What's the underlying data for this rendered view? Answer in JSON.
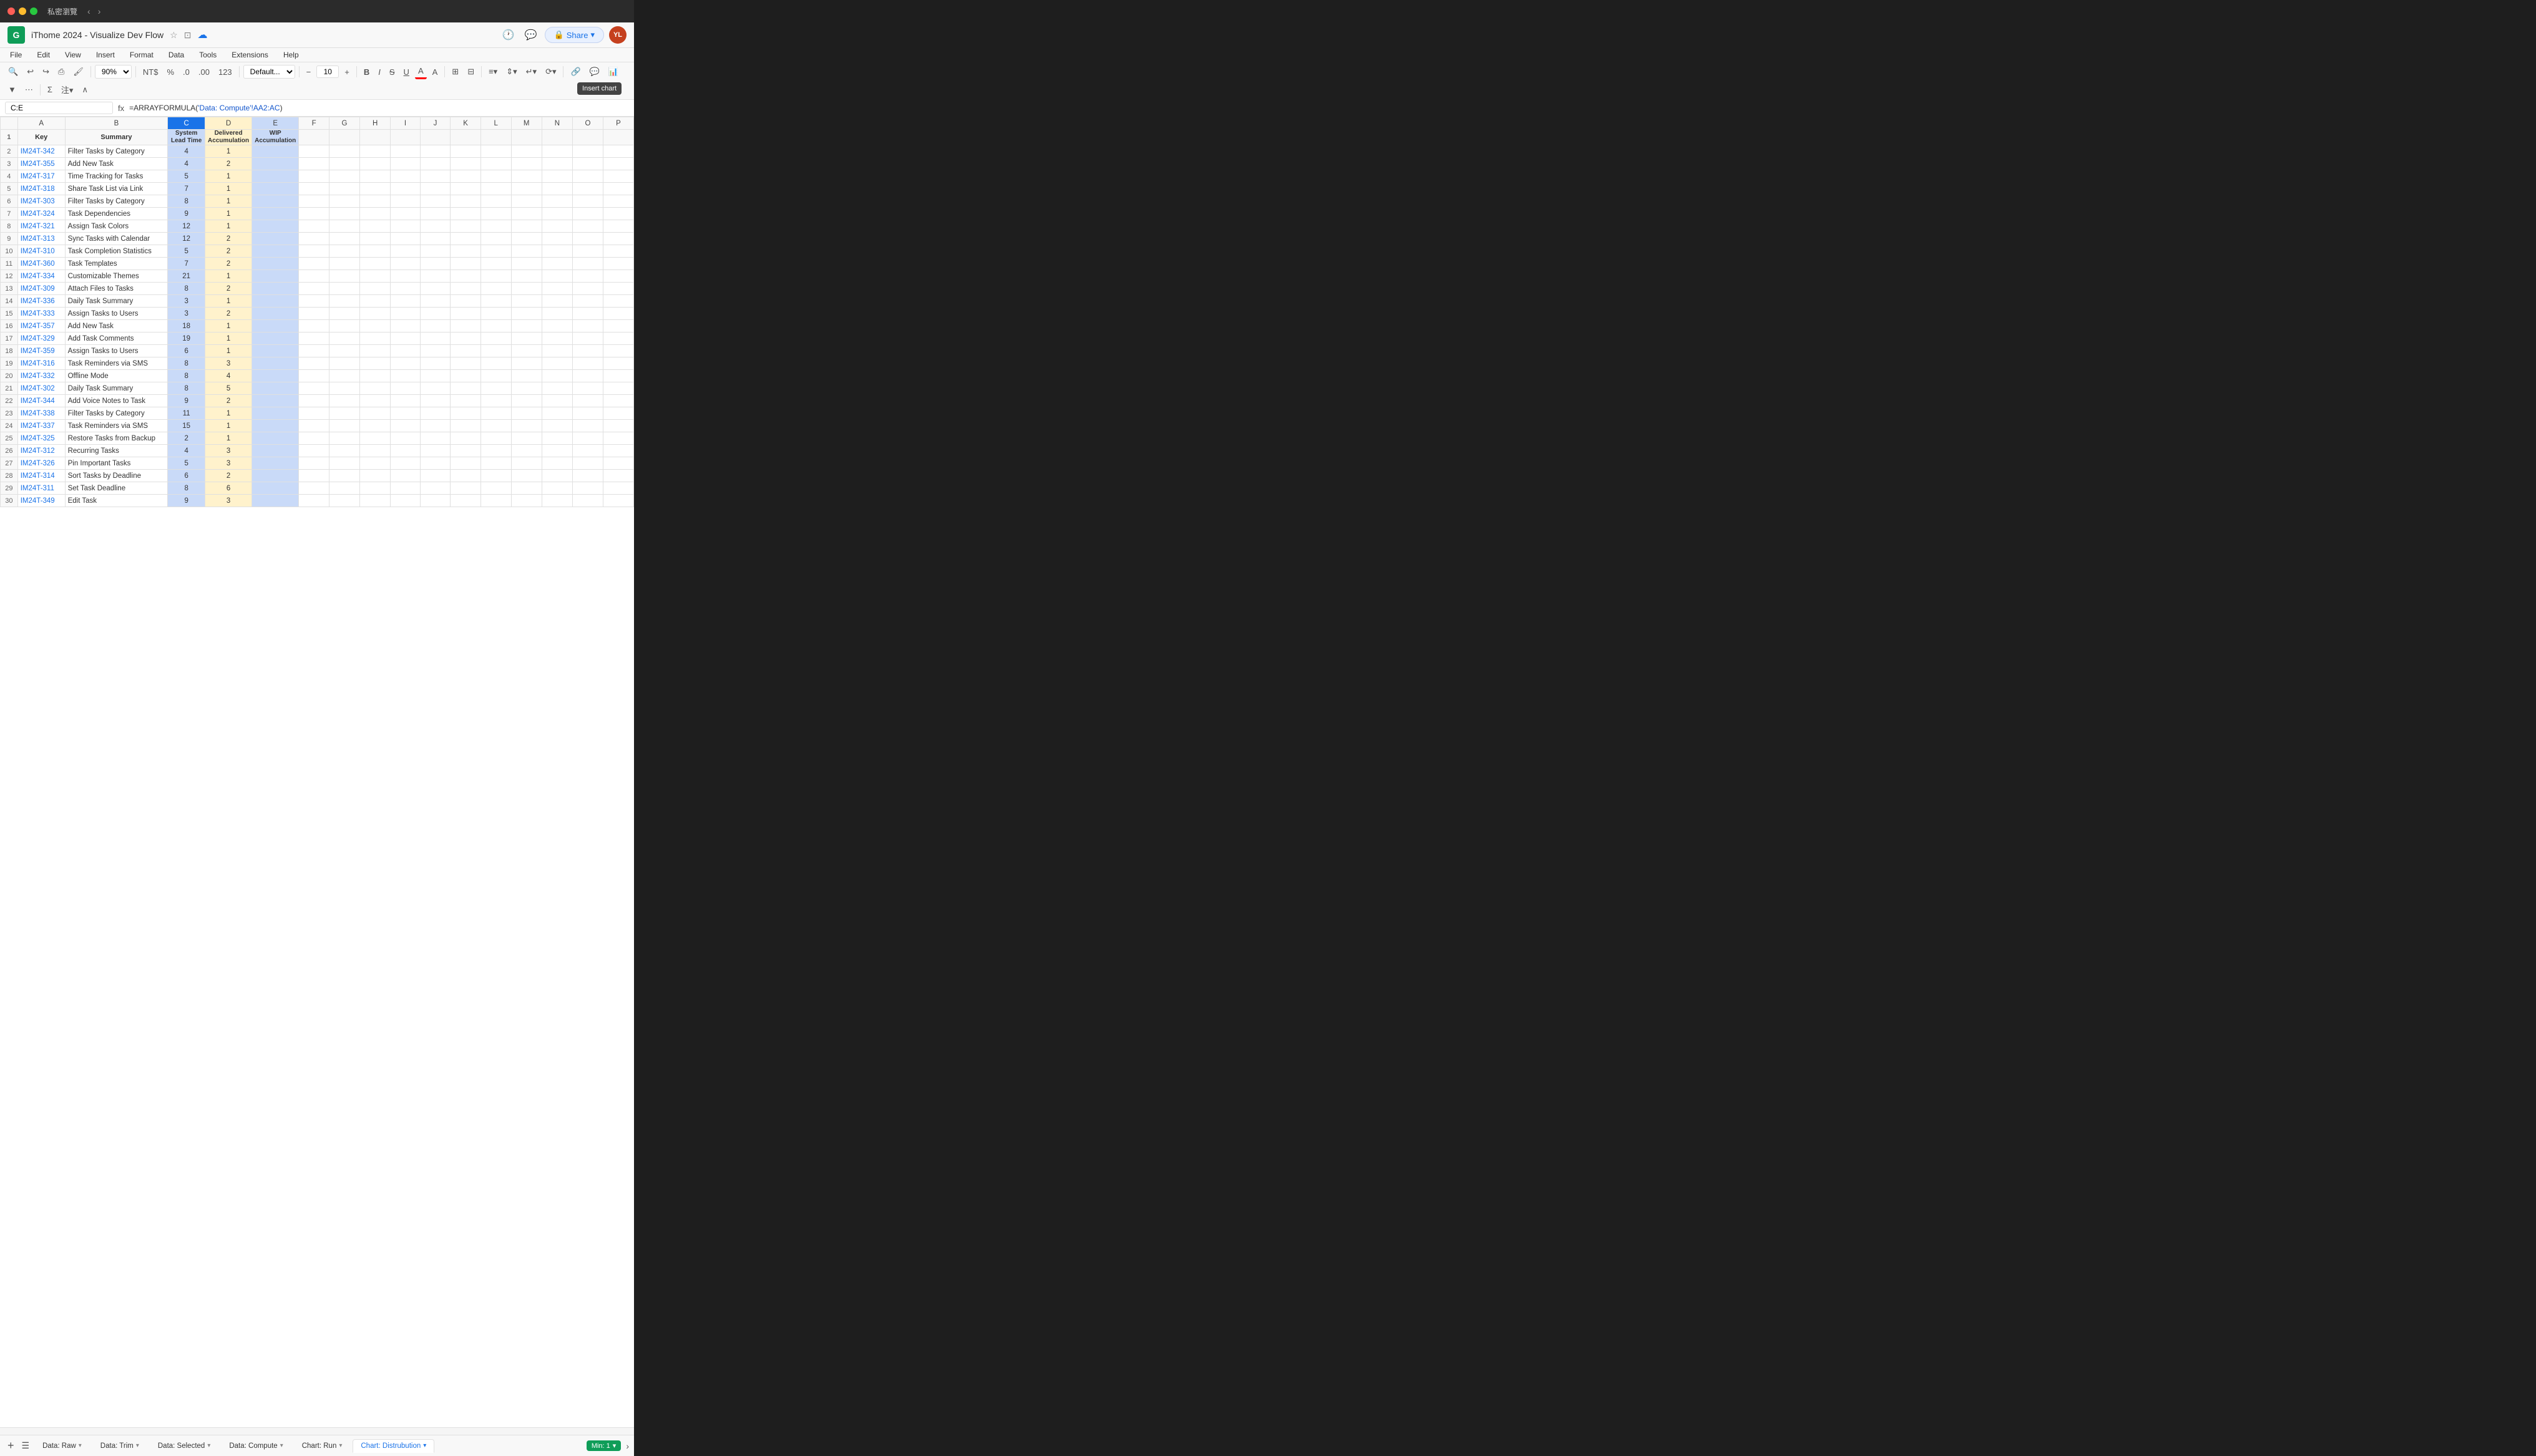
{
  "titlebar": {
    "title": "私密瀏覽",
    "back_label": "‹",
    "forward_label": "›"
  },
  "app": {
    "logo_text": "G",
    "title": "iThome 2024 - Visualize Dev Flow",
    "star_icon": "☆",
    "folder_icon": "⊡",
    "cloud_icon": "☁",
    "history_icon": "🕐",
    "comment_icon": "💬",
    "share_label": "Share",
    "share_lock_icon": "🔒",
    "share_arrow_icon": "▾",
    "avatar_initials": "YL"
  },
  "menu": {
    "items": [
      "File",
      "Edit",
      "View",
      "Insert",
      "Format",
      "Data",
      "Tools",
      "Extensions",
      "Help"
    ]
  },
  "toolbar": {
    "search_icon": "🔍",
    "undo_icon": "↩",
    "redo_icon": "↪",
    "print_icon": "⎙",
    "paint_icon": "🖌",
    "zoom_value": "90%",
    "currency_label": "NT$",
    "percent_label": "%",
    "decimal_dec": ".0",
    "decimal_inc": ".00",
    "format_123": "123",
    "font_family": "Default...",
    "font_size": "10",
    "bold": "B",
    "italic": "I",
    "strike": "S̶",
    "underline": "U",
    "text_color": "A",
    "highlight": "A",
    "borders": "⊞",
    "merge": "⊟",
    "align_h": "≡",
    "align_v": "≡",
    "wrap": "↵",
    "rotate": "⟳",
    "link": "🔗",
    "comment": "💬",
    "chart_icon": "📊",
    "filter": "▼",
    "more": "⋯",
    "sum": "Σ",
    "tooltip_insert_chart": "Insert chart"
  },
  "formula_bar": {
    "cell_ref": "C:E",
    "formula_text": "=ARRAYFORMULA(",
    "formula_ref": "'Data: Compute'!AA2:AC",
    "formula_close": ")"
  },
  "columns": {
    "row_header": "",
    "A": "A",
    "B": "B",
    "C": "C",
    "D": "D",
    "E": "E",
    "F": "F",
    "G": "G",
    "H": "H",
    "I": "I",
    "J": "J",
    "K": "K",
    "L": "L",
    "M": "M",
    "N": "N",
    "O": "O",
    "P": "P"
  },
  "header_row": {
    "key": "Key",
    "summary": "Summary",
    "system_lead_time": "System Lead Time",
    "delivered_accumulation": "Delivered Accumulation",
    "wip_accumulation": "WIP Accumulation"
  },
  "rows": [
    {
      "num": 2,
      "key": "IM24T-342",
      "summary": "Filter Tasks by Category",
      "c": 4,
      "d": 1,
      "e": ""
    },
    {
      "num": 3,
      "key": "IM24T-355",
      "summary": "Add New Task",
      "c": 4,
      "d": 2,
      "e": ""
    },
    {
      "num": 4,
      "key": "IM24T-317",
      "summary": "Time Tracking for Tasks",
      "c": 5,
      "d": 1,
      "e": ""
    },
    {
      "num": 5,
      "key": "IM24T-318",
      "summary": "Share Task List via Link",
      "c": 7,
      "d": 1,
      "e": ""
    },
    {
      "num": 6,
      "key": "IM24T-303",
      "summary": "Filter Tasks by Category",
      "c": 8,
      "d": 1,
      "e": ""
    },
    {
      "num": 7,
      "key": "IM24T-324",
      "summary": "Task Dependencies",
      "c": 9,
      "d": 1,
      "e": ""
    },
    {
      "num": 8,
      "key": "IM24T-321",
      "summary": "Assign Task Colors",
      "c": 12,
      "d": 1,
      "e": ""
    },
    {
      "num": 9,
      "key": "IM24T-313",
      "summary": "Sync Tasks with Calendar",
      "c": 12,
      "d": 2,
      "e": ""
    },
    {
      "num": 10,
      "key": "IM24T-310",
      "summary": "Task Completion Statistics",
      "c": 5,
      "d": 2,
      "e": ""
    },
    {
      "num": 11,
      "key": "IM24T-360",
      "summary": "Task Templates",
      "c": 7,
      "d": 2,
      "e": ""
    },
    {
      "num": 12,
      "key": "IM24T-334",
      "summary": "Customizable Themes",
      "c": 21,
      "d": 1,
      "e": ""
    },
    {
      "num": 13,
      "key": "IM24T-309",
      "summary": "Attach Files to Tasks",
      "c": 8,
      "d": 2,
      "e": ""
    },
    {
      "num": 14,
      "key": "IM24T-336",
      "summary": "Daily Task Summary",
      "c": 3,
      "d": 1,
      "e": ""
    },
    {
      "num": 15,
      "key": "IM24T-333",
      "summary": "Assign Tasks to Users",
      "c": 3,
      "d": 2,
      "e": ""
    },
    {
      "num": 16,
      "key": "IM24T-357",
      "summary": "Add New Task",
      "c": 18,
      "d": 1,
      "e": ""
    },
    {
      "num": 17,
      "key": "IM24T-329",
      "summary": "Add Task Comments",
      "c": 19,
      "d": 1,
      "e": ""
    },
    {
      "num": 18,
      "key": "IM24T-359",
      "summary": "Assign Tasks to Users",
      "c": 6,
      "d": 1,
      "e": ""
    },
    {
      "num": 19,
      "key": "IM24T-316",
      "summary": "Task Reminders via SMS",
      "c": 8,
      "d": 3,
      "e": ""
    },
    {
      "num": 20,
      "key": "IM24T-332",
      "summary": "Offline Mode",
      "c": 8,
      "d": 4,
      "e": ""
    },
    {
      "num": 21,
      "key": "IM24T-302",
      "summary": "Daily Task Summary",
      "c": 8,
      "d": 5,
      "e": ""
    },
    {
      "num": 22,
      "key": "IM24T-344",
      "summary": "Add Voice Notes to Task",
      "c": 9,
      "d": 2,
      "e": ""
    },
    {
      "num": 23,
      "key": "IM24T-338",
      "summary": "Filter Tasks by Category",
      "c": 11,
      "d": 1,
      "e": ""
    },
    {
      "num": 24,
      "key": "IM24T-337",
      "summary": "Task Reminders via SMS",
      "c": 15,
      "d": 1,
      "e": ""
    },
    {
      "num": 25,
      "key": "IM24T-325",
      "summary": "Restore Tasks from Backup",
      "c": 2,
      "d": 1,
      "e": ""
    },
    {
      "num": 26,
      "key": "IM24T-312",
      "summary": "Recurring Tasks",
      "c": 4,
      "d": 3,
      "e": ""
    },
    {
      "num": 27,
      "key": "IM24T-326",
      "summary": "Pin Important Tasks",
      "c": 5,
      "d": 3,
      "e": ""
    },
    {
      "num": 28,
      "key": "IM24T-314",
      "summary": "Sort Tasks by Deadline",
      "c": 6,
      "d": 2,
      "e": ""
    },
    {
      "num": 29,
      "key": "IM24T-311",
      "summary": "Set Task Deadline",
      "c": 8,
      "d": 6,
      "e": ""
    },
    {
      "num": 30,
      "key": "IM24T-349",
      "summary": "Edit Task",
      "c": 9,
      "d": 3,
      "e": ""
    }
  ],
  "tabs": [
    {
      "label": "Data: Raw",
      "active": false
    },
    {
      "label": "Data: Trim",
      "active": false
    },
    {
      "label": "Data: Selected",
      "active": false
    },
    {
      "label": "Data: Compute",
      "active": false
    },
    {
      "label": "Chart: Run",
      "active": false
    },
    {
      "label": "Chart: Distrubution",
      "active": true
    }
  ],
  "bottom": {
    "add_sheet_icon": "+",
    "menu_icon": "☰",
    "min_label": "Min: 1",
    "arrow_right": "›"
  }
}
